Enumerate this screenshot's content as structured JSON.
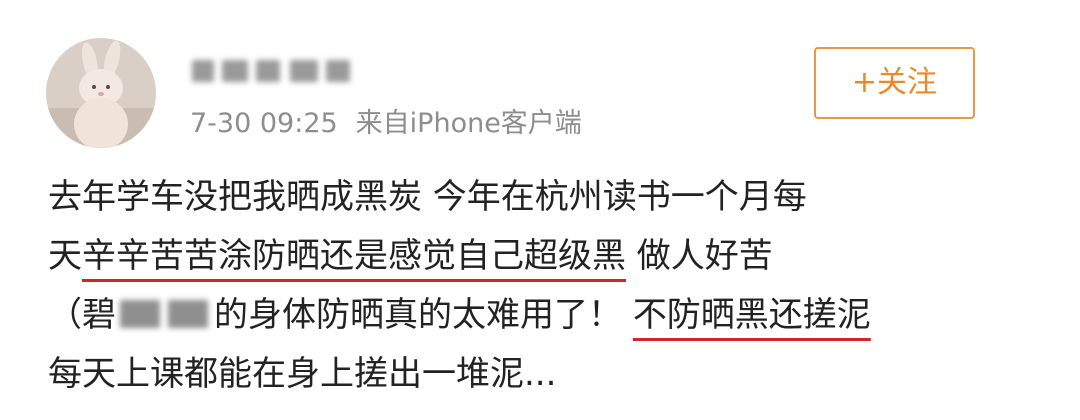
{
  "post": {
    "avatar_icon": "bunny-plush-avatar",
    "timestamp": "7-30 09:25",
    "source": "来自iPhone客户端",
    "follow_label": "+关注",
    "line1": "去年学车没把我晒成黑炭 今年在杭州读书一个月每",
    "line2_prefix": "天",
    "line2_highlight": "辛辛苦苦涂防晒还是感觉自己超级黑",
    "line2_suffix": " 做人好苦",
    "line3_prefix": "（碧",
    "line3_middle": "的身体防晒真的太难用了！ ",
    "line3_highlight": "不防晒黑还搓泥",
    "line4": "每天上课都能在身上搓出一堆泥..."
  },
  "colors": {
    "accent_orange": "#e98a2a",
    "underline_red": "#d0282a",
    "meta_gray": "#8d8d8d"
  }
}
